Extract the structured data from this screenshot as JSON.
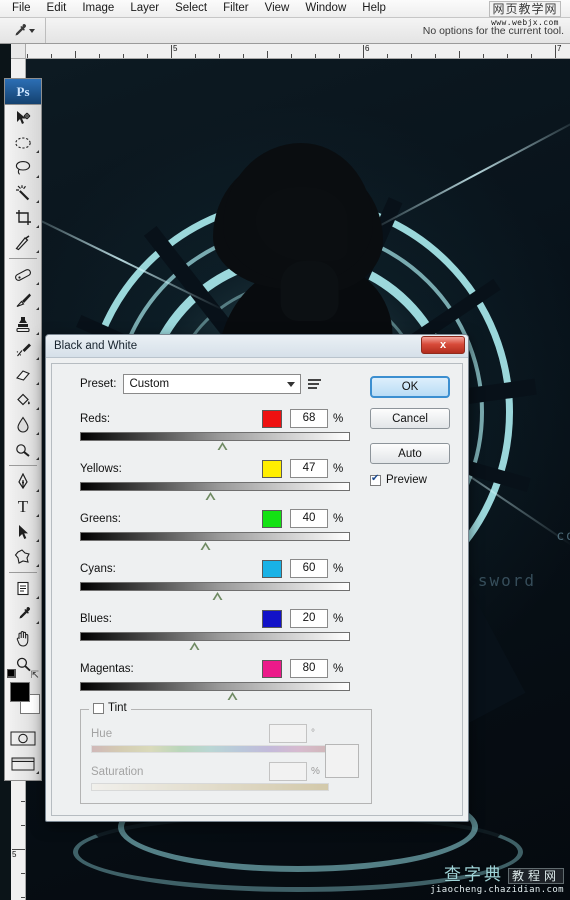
{
  "app": {
    "name": "Adobe Photoshop",
    "logo_text": "Ps"
  },
  "menubar": {
    "items": [
      {
        "label": "File"
      },
      {
        "label": "Edit"
      },
      {
        "label": "Image"
      },
      {
        "label": "Layer"
      },
      {
        "label": "Select"
      },
      {
        "label": "Filter"
      },
      {
        "label": "View"
      },
      {
        "label": "Window"
      },
      {
        "label": "Help"
      }
    ]
  },
  "options_bar": {
    "active_tool_icon": "eyedropper-icon",
    "notice": "No options for the current tool."
  },
  "watermark_top": {
    "chinese": "网页教学网",
    "url": "www.webjx.com"
  },
  "watermark_bottom": {
    "chinese_1": "查字典",
    "chinese_2": "教程网",
    "url": "jiaocheng.chazidian.com"
  },
  "rulers": {
    "horizontal_labels": [
      "5",
      "6",
      "7"
    ],
    "vertical_labels": [
      "5"
    ],
    "unit": "inches"
  },
  "toolbar": {
    "tools": [
      {
        "name": "move-tool",
        "icon": "arrow-move-icon"
      },
      {
        "name": "elliptical-marquee-tool",
        "icon": "ellipse-dashed-icon"
      },
      {
        "name": "lasso-tool",
        "icon": "lasso-icon"
      },
      {
        "name": "magic-wand-tool",
        "icon": "magic-wand-icon"
      },
      {
        "name": "crop-tool",
        "icon": "crop-icon"
      },
      {
        "name": "slice-tool",
        "icon": "knife-icon"
      },
      {
        "name": "healing-brush-tool",
        "icon": "bandage-icon"
      },
      {
        "name": "brush-tool",
        "icon": "brush-icon"
      },
      {
        "name": "clone-stamp-tool",
        "icon": "stamp-icon"
      },
      {
        "name": "history-brush-tool",
        "icon": "history-brush-icon"
      },
      {
        "name": "eraser-tool",
        "icon": "eraser-icon"
      },
      {
        "name": "paint-bucket-tool",
        "icon": "paint-bucket-icon"
      },
      {
        "name": "blur-tool",
        "icon": "waterdrop-icon"
      },
      {
        "name": "dodge-tool",
        "icon": "dodge-icon"
      },
      {
        "name": "pen-tool",
        "icon": "pen-nib-icon"
      },
      {
        "name": "type-tool",
        "icon": "text-t-icon"
      },
      {
        "name": "path-selection-tool",
        "icon": "arrow-pointer-icon"
      },
      {
        "name": "custom-shape-tool",
        "icon": "blob-shape-icon"
      },
      {
        "name": "notes-tool",
        "icon": "note-icon"
      },
      {
        "name": "eyedropper-tool",
        "icon": "eyedropper-icon"
      },
      {
        "name": "hand-tool",
        "icon": "hand-icon"
      },
      {
        "name": "zoom-tool",
        "icon": "magnifier-icon"
      }
    ],
    "foreground_color": "#000000",
    "background_color": "#ffffff",
    "quick_mask_icon": "quick-mask-icon",
    "screen_mode_icon": "screen-mode-icon"
  },
  "dialog": {
    "title": "Black and White",
    "close_label": "x",
    "preset": {
      "label": "Preset:",
      "value": "Custom",
      "menu_icon": "preset-menu-icon"
    },
    "buttons": {
      "ok": "OK",
      "cancel": "Cancel",
      "auto": "Auto"
    },
    "preview": {
      "label": "Preview",
      "checked": true
    },
    "unit": "%",
    "sliders": [
      {
        "label": "Reds:",
        "value": "68",
        "chip": "#ee1111",
        "pos": 53.0
      },
      {
        "label": "Yellows:",
        "value": "47",
        "chip": "#ffee00",
        "pos": 48.5
      },
      {
        "label": "Greens:",
        "value": "40",
        "chip": "#13e113",
        "pos": 46.5
      },
      {
        "label": "Cyans:",
        "value": "60",
        "chip": "#19b2e6",
        "pos": 51.0
      },
      {
        "label": "Blues:",
        "value": "20",
        "chip": "#1212c8",
        "pos": 42.5
      },
      {
        "label": "Magentas:",
        "value": "80",
        "chip": "#ec1a8a",
        "pos": 56.5
      }
    ],
    "tint": {
      "label": "Tint",
      "checked": false,
      "hue": {
        "label": "Hue",
        "value": "",
        "unit": "°"
      },
      "saturation": {
        "label": "Saturation",
        "value": "",
        "unit": "%"
      }
    }
  },
  "canvas": {
    "tech_text_1": "sword",
    "tech_text_2": "co"
  }
}
